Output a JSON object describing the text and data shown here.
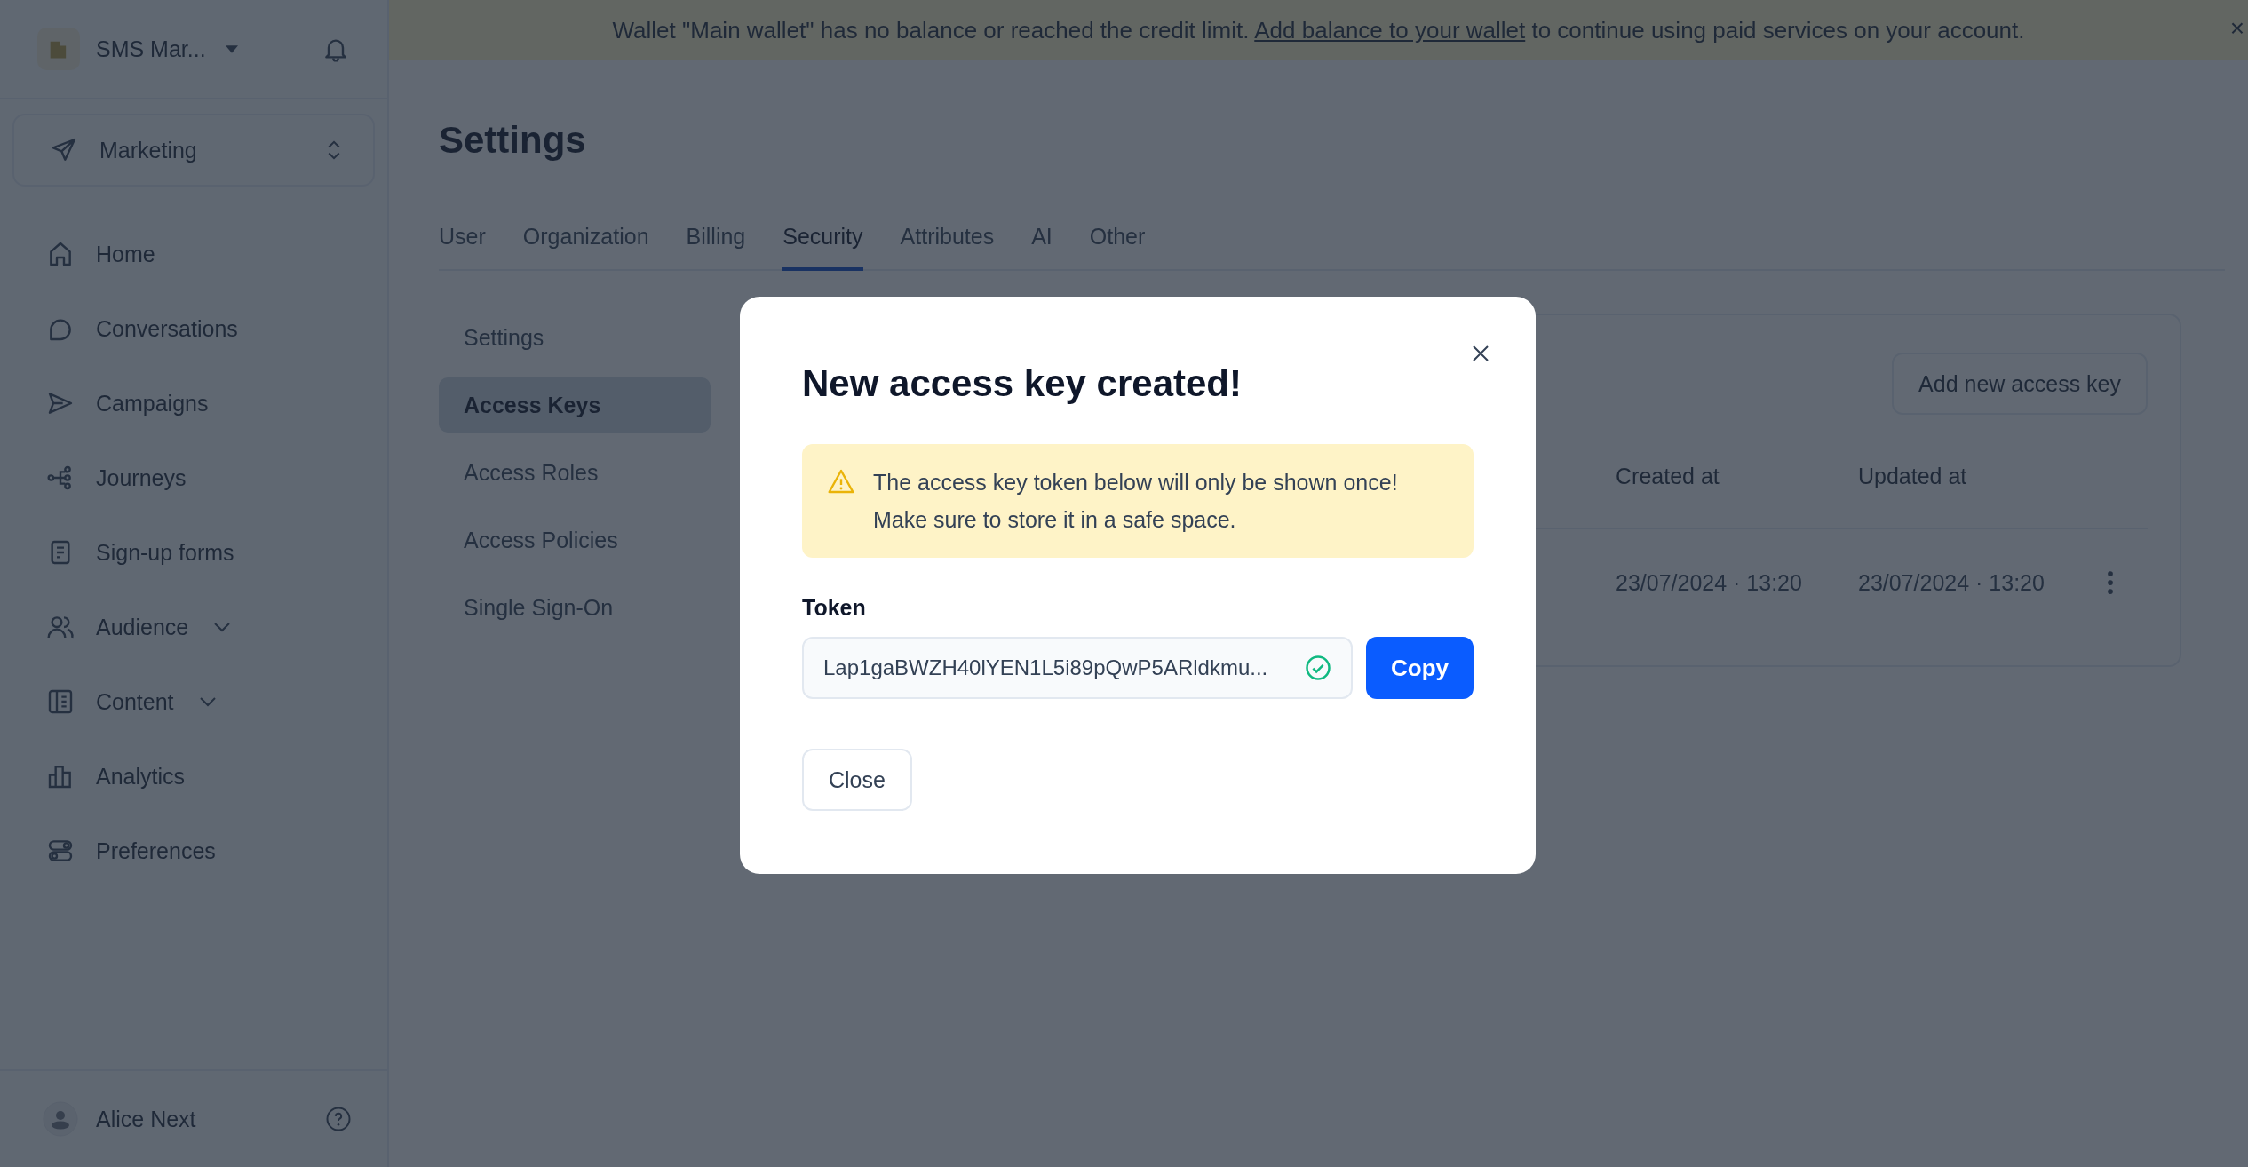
{
  "banner": {
    "text_before": "Wallet \"Main wallet\" has no balance or reached the credit limit.",
    "link": "Add balance to your wallet",
    "text_after": "to continue using paid services on your account.",
    "close": "×"
  },
  "sidebar": {
    "workspace": "SMS Mar...",
    "app_switcher": "Marketing",
    "items": [
      {
        "label": "Home",
        "expandable": false
      },
      {
        "label": "Conversations",
        "expandable": false
      },
      {
        "label": "Campaigns",
        "expandable": false
      },
      {
        "label": "Journeys",
        "expandable": false
      },
      {
        "label": "Sign-up forms",
        "expandable": false
      },
      {
        "label": "Audience",
        "expandable": true
      },
      {
        "label": "Content",
        "expandable": true
      },
      {
        "label": "Analytics",
        "expandable": false
      },
      {
        "label": "Preferences",
        "expandable": false
      }
    ],
    "user": "Alice Next"
  },
  "page": {
    "title": "Settings",
    "tabs": [
      {
        "label": "User",
        "selected": false
      },
      {
        "label": "Organization",
        "selected": false
      },
      {
        "label": "Billing",
        "selected": false
      },
      {
        "label": "Security",
        "selected": true
      },
      {
        "label": "Attributes",
        "selected": false
      },
      {
        "label": "AI",
        "selected": false
      },
      {
        "label": "Other",
        "selected": false
      }
    ],
    "subnav": [
      {
        "label": "Settings",
        "selected": false
      },
      {
        "label": "Access Keys",
        "selected": true
      },
      {
        "label": "Access Roles",
        "selected": false
      },
      {
        "label": "Access Policies",
        "selected": false
      },
      {
        "label": "Single Sign-On",
        "selected": false
      }
    ],
    "add_button": "Add new access key",
    "table": {
      "columns": [
        "Created at",
        "Updated at"
      ],
      "rows": [
        {
          "cells": [
            "23/07/2024 · 13:20",
            "23/07/2024 · 13:20"
          ]
        }
      ]
    }
  },
  "modal": {
    "title": "New access key created!",
    "warning": [
      "The access key token below will only be shown once!",
      "Make sure to store it in a safe space."
    ],
    "token_label": "Token",
    "token_value": "Lap1gaBWZH40lYEN1L5i89pQwP5ARldkmu...",
    "token_valid": true,
    "copy_button": "Copy",
    "close_button": "Close"
  }
}
